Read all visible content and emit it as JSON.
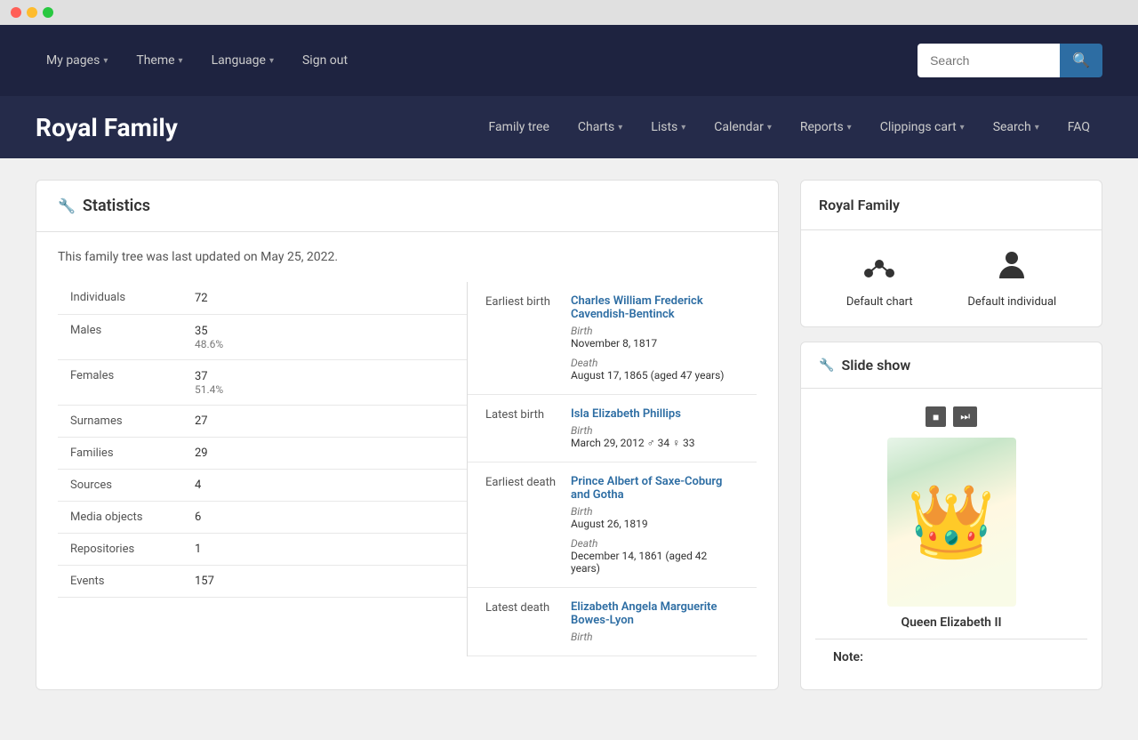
{
  "titlebar": {
    "buttons": [
      "red",
      "yellow",
      "green"
    ]
  },
  "topnav": {
    "items": [
      {
        "label": "My pages",
        "hasChevron": true
      },
      {
        "label": "Theme",
        "hasChevron": true
      },
      {
        "label": "Language",
        "hasChevron": true
      },
      {
        "label": "Sign out",
        "hasChevron": false
      }
    ],
    "search": {
      "placeholder": "Search",
      "button_icon": "🔍"
    }
  },
  "brandnav": {
    "title": "Royal Family",
    "items": [
      {
        "label": "Family tree",
        "hasChevron": false
      },
      {
        "label": "Charts",
        "hasChevron": true
      },
      {
        "label": "Lists",
        "hasChevron": true
      },
      {
        "label": "Calendar",
        "hasChevron": true
      },
      {
        "label": "Reports",
        "hasChevron": true
      },
      {
        "label": "Clippings cart",
        "hasChevron": true
      },
      {
        "label": "Search",
        "hasChevron": true
      },
      {
        "label": "FAQ",
        "hasChevron": false
      }
    ]
  },
  "statistics": {
    "header": "Statistics",
    "updated_text": "This family tree was last updated on May 25, 2022.",
    "rows": [
      {
        "label": "Individuals",
        "value": "72",
        "sub": ""
      },
      {
        "label": "Males",
        "value": "35",
        "sub": "48.6%"
      },
      {
        "label": "Females",
        "value": "37",
        "sub": "51.4%"
      },
      {
        "label": "Surnames",
        "value": "27",
        "sub": ""
      },
      {
        "label": "Families",
        "value": "29",
        "sub": ""
      },
      {
        "label": "Sources",
        "value": "4",
        "sub": ""
      },
      {
        "label": "Media objects",
        "value": "6",
        "sub": ""
      },
      {
        "label": "Repositories",
        "value": "1",
        "sub": ""
      },
      {
        "label": "Events",
        "value": "157",
        "sub": ""
      }
    ],
    "events": [
      {
        "type": "Earliest birth",
        "name": "Charles William Frederick Cavendish-Bentinck",
        "birth_label": "Birth",
        "birth_date": "November 8, 1817",
        "death_label": "Death",
        "death_date": "August 17, 1865 (aged 47 years)"
      },
      {
        "type": "Latest birth",
        "name": "Isla Elizabeth Phillips",
        "birth_label": "Birth",
        "birth_date": "March 29, 2012",
        "birth_extra": "♂ 34  ♀ 33",
        "death_label": "",
        "death_date": ""
      },
      {
        "type": "Earliest death",
        "name": "Prince Albert of Saxe-Coburg and Gotha",
        "birth_label": "Birth",
        "birth_date": "August 26, 1819",
        "death_label": "Death",
        "death_date": "December 14, 1861 (aged 42 years)"
      },
      {
        "type": "Latest death",
        "name": "Elizabeth Angela Marguerite Bowes-Lyon",
        "birth_label": "Birth",
        "birth_date": "",
        "death_label": "",
        "death_date": ""
      }
    ]
  },
  "sidebar": {
    "royal_family": {
      "title": "Royal Family",
      "default_chart_label": "Default chart",
      "default_individual_label": "Default individual"
    },
    "slideshow": {
      "title": "Slide show",
      "caption": "Queen Elizabeth II",
      "note_label": "Note:"
    }
  }
}
